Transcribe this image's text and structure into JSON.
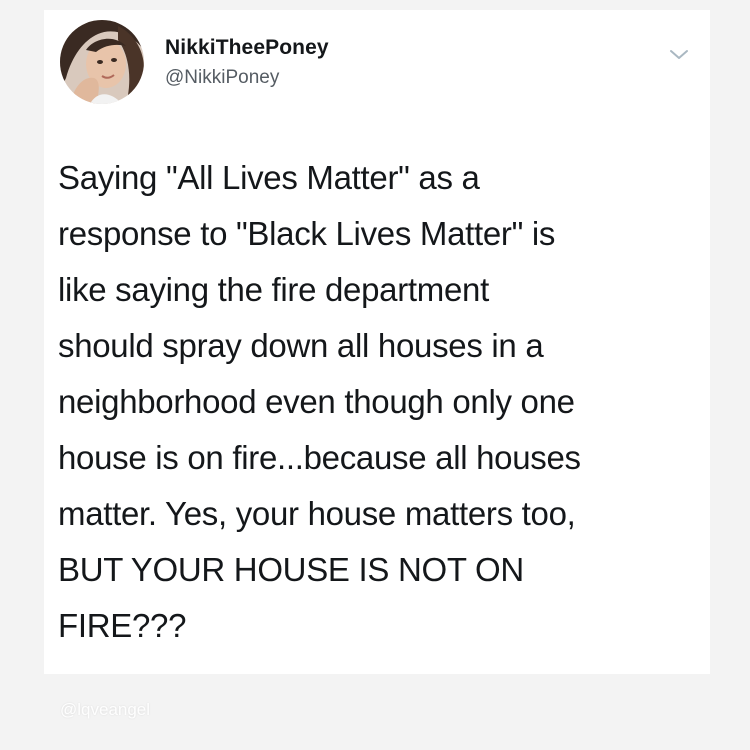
{
  "tweet": {
    "display_name": "NikkiTheePoney",
    "handle": "@NikkiPoney",
    "menu_icon": "chevron-down-icon",
    "lines": [
      "Saying \"All Lives Matter\" as a",
      "response to \"Black Lives Matter\" is",
      "like saying the fire department",
      "should spray down all houses in a",
      "neighborhood even though only one",
      "house is on fire...because all houses",
      "matter. Yes, your house matters too,",
      "BUT YOUR HOUSE IS NOT ON",
      "FIRE???"
    ]
  },
  "watermark": {
    "text": "@lqveangel"
  },
  "colors": {
    "background": "#f3f3f3",
    "card": "#ffffff",
    "text": "#14171a",
    "secondary_text": "#555c63",
    "chevron": "#aab8c2"
  }
}
